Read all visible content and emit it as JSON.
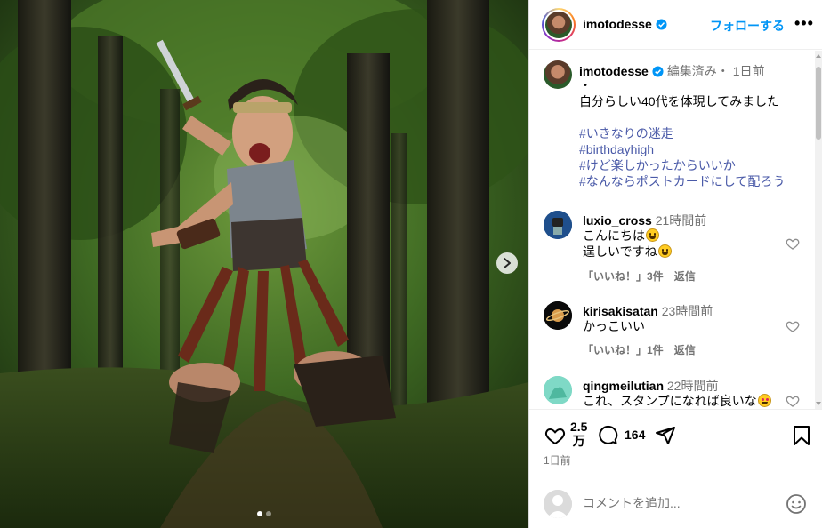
{
  "post": {
    "username": "imotodesse",
    "follow_label": "フォローする",
    "more_label": "•••",
    "carousel": {
      "count": 2,
      "active": 0
    }
  },
  "caption": {
    "username": "imotodesse",
    "meta": "編集済み・ 1日前",
    "lines": [
      "・",
      "自分らしい40代を体現してみました"
    ],
    "hashtags": [
      "#いきなりの迷走",
      "#birthdayhigh",
      "#けど楽しかったからいいか",
      "#なんならポストカードにして配ろう"
    ]
  },
  "comments": [
    {
      "username": "luxio_cross",
      "time": "21時間前",
      "lines": [
        "こんにちは",
        "逞しいですね"
      ],
      "likes_label": "「いいね！」3件",
      "reply_label": "返信"
    },
    {
      "username": "kirisakisatan",
      "time": "23時間前",
      "lines": [
        "かっこいい"
      ],
      "likes_label": "「いいね！」1件",
      "reply_label": "返信"
    },
    {
      "username": "qingmeilutian",
      "time": "22時間前",
      "lines": [
        "これ、スタンプになれば良いな"
      ],
      "likes_label": "",
      "reply_label": ""
    }
  ],
  "actions": {
    "likes_top": "2.5",
    "likes_bottom": "万",
    "comments_count": "164",
    "date": "1日前"
  },
  "comment_input": {
    "placeholder": "コメントを追加..."
  },
  "colors": {
    "link": "#0095f6",
    "hashtag": "#4a5aa8",
    "muted": "#737373"
  }
}
